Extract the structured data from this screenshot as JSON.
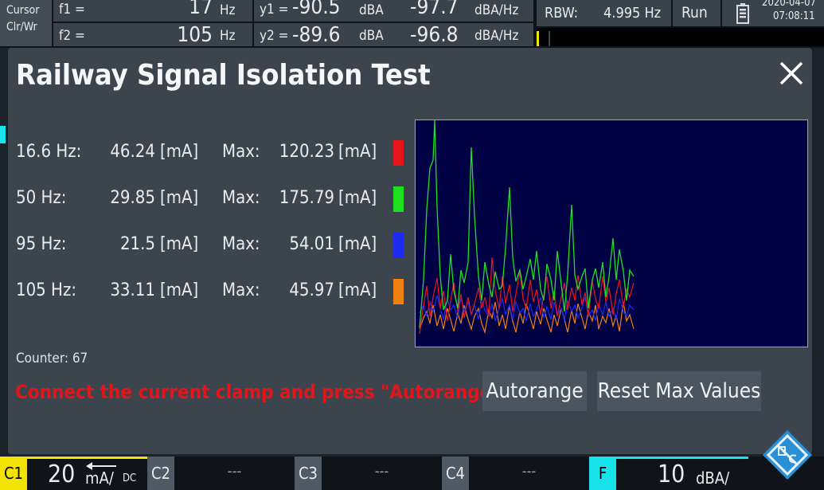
{
  "header": {
    "cursor_label": "Cursor",
    "clrwr_label": "Clr/Wr",
    "f1_label": "f1 =",
    "f1_value": "17",
    "f1_unit": "Hz",
    "f2_label": "f2 =",
    "f2_value": "105",
    "f2_unit": "Hz",
    "y1_label": "y1 =",
    "y1_value": "-90.5",
    "y1_unit": "dBA",
    "y1_density": "-97.7",
    "y1_density_unit": "dBA/Hz",
    "y2_label": "y2 =",
    "y2_value": "-89.6",
    "y2_unit": "dBA",
    "y2_density": "-96.8",
    "y2_density_unit": "dBA/Hz",
    "rbw_label": "RBW:",
    "rbw_value": "4.995 Hz",
    "run_label": "Run",
    "date": "2020-04-07",
    "time": "07:08:11"
  },
  "dialog": {
    "title": "Railway Signal Isolation Test",
    "rows": [
      {
        "freq": "16.6 Hz:",
        "value": "46.24",
        "unit": "[mA]",
        "max_label": "Max:",
        "max": "120.23",
        "max_unit": "[mA]",
        "color": "#e8141c"
      },
      {
        "freq": "50 Hz:",
        "value": "29.85",
        "unit": "[mA]",
        "max_label": "Max:",
        "max": "175.79",
        "max_unit": "[mA]",
        "color": "#1fe01f"
      },
      {
        "freq": "95 Hz:",
        "value": "21.5",
        "unit": "[mA]",
        "max_label": "Max:",
        "max": "54.01",
        "max_unit": "[mA]",
        "color": "#1c2cf0"
      },
      {
        "freq": "105 Hz:",
        "value": "33.11",
        "unit": "[mA]",
        "max_label": "Max:",
        "max": "45.97",
        "max_unit": "[mA]",
        "color": "#f08010"
      }
    ],
    "counter": "Counter: 67",
    "message": "Connect the current clamp and press \"Autorange\" →",
    "autorange_label": "Autorange",
    "reset_label": "Reset Max Values"
  },
  "footer": {
    "c1_label": "C1",
    "c1_value": "20",
    "c1_unit": "mA/",
    "c1_coupling": "DC",
    "c2_label": "C2",
    "c2_value": "---",
    "c3_label": "C3",
    "c3_value": "---",
    "c4_label": "C4",
    "c4_value": "---",
    "f_label": "F",
    "f_value": "10",
    "f_unit": "dBA/"
  },
  "colors": {
    "c1": "#f2e400",
    "f": "#19e3ea",
    "message": "#e3141a"
  },
  "icons": [
    "battery-icon",
    "close-icon",
    "rohde-schwarz-logo-icon"
  ]
}
